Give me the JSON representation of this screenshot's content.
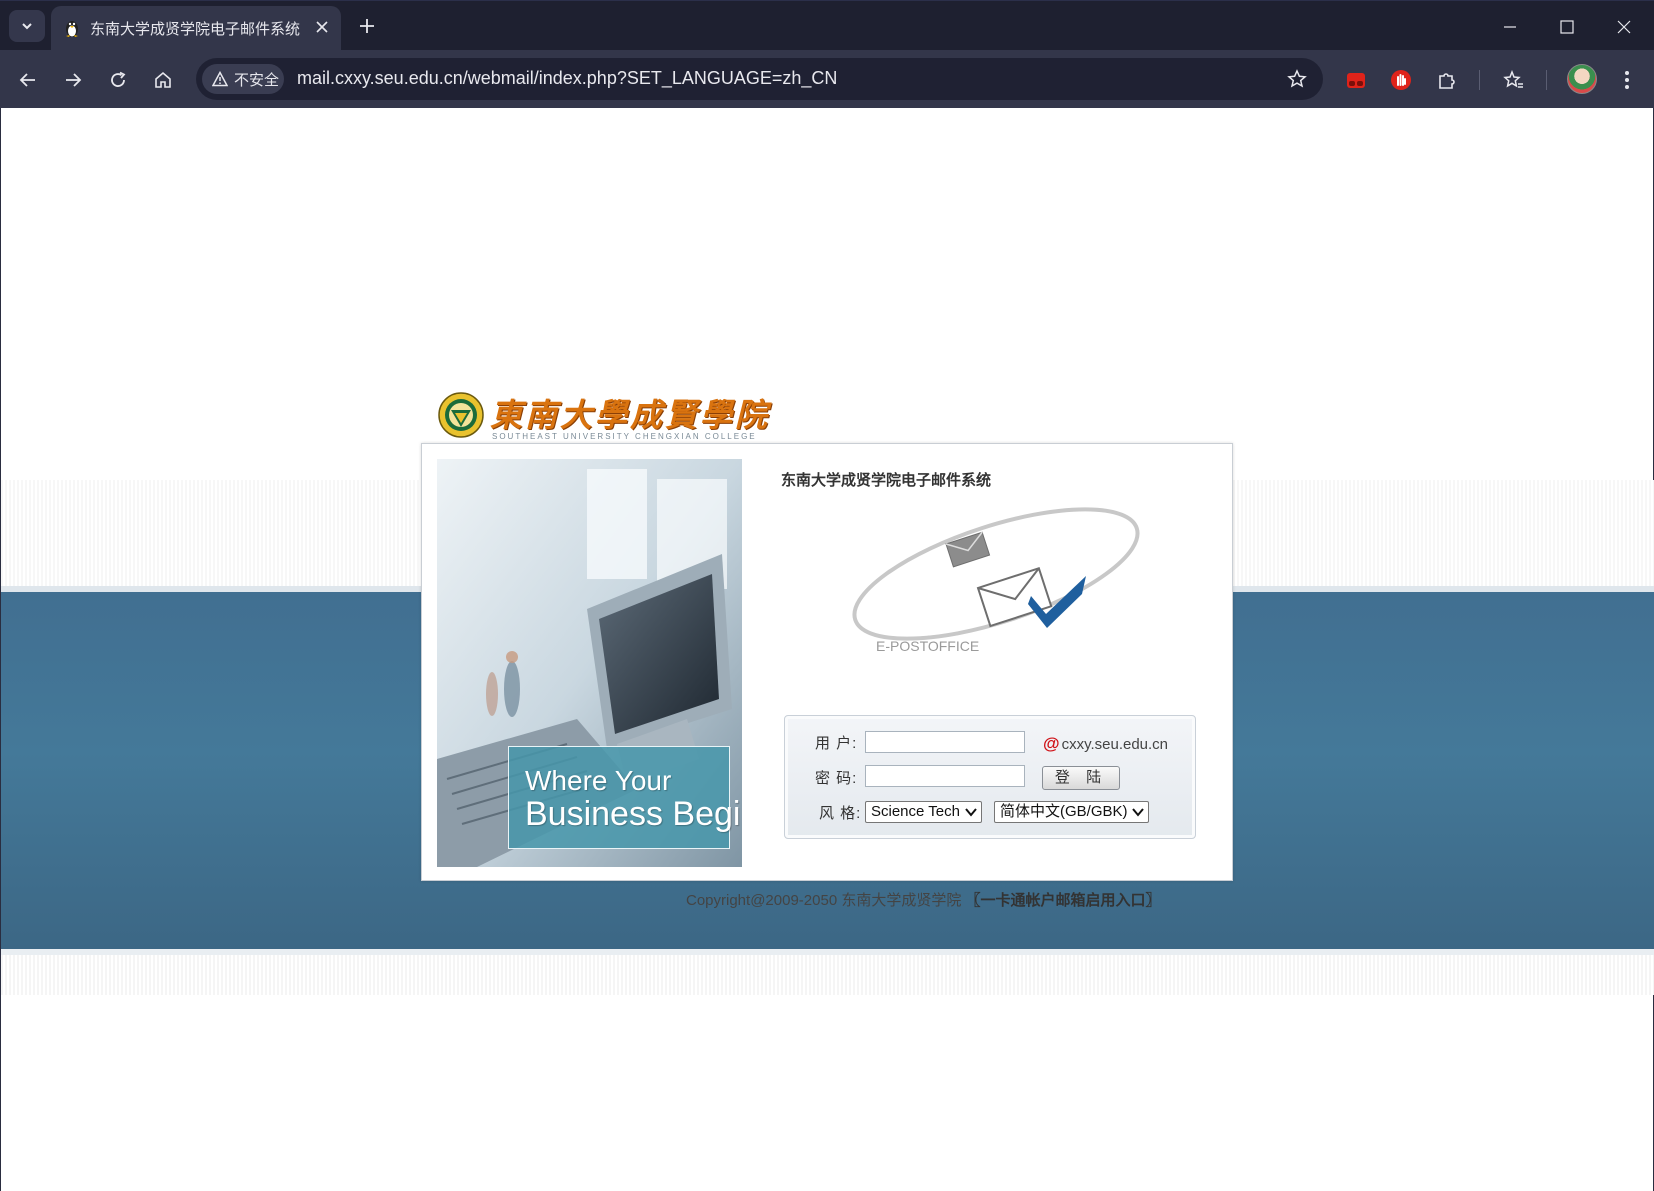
{
  "browser": {
    "tab_title": "东南大学成贤学院电子邮件系统",
    "security_label": "不安全",
    "url": "mail.cxxy.seu.edu.cn/webmail/index.php?SET_LANGUAGE=zh_CN"
  },
  "logo": {
    "name_cn": "東南大學成賢學院",
    "name_en": "SOUTHEAST UNIVERSITY CHENGXIAN COLLEGE"
  },
  "banner": {
    "slogan_line1": "Where Your",
    "slogan_line2": "Business Begins !"
  },
  "login": {
    "system_title": "东南大学成贤学院电子邮件系统",
    "epost_label": "E-POSTOFFICE",
    "user_label": "用 户:",
    "user_value": "",
    "domain_at": "@",
    "domain": "cxxy.seu.edu.cn",
    "password_label": "密 码:",
    "password_value": "",
    "login_button": "登 陆",
    "style_label": "风 格:",
    "style_selected": "Science Tech",
    "language_selected": "简体中文(GB/GBK)"
  },
  "footer": {
    "copyright": "Copyright@2009-2050 东南大学成贤学院",
    "link_text": "〖一卡通帐户邮箱启用入口〗"
  },
  "colors": {
    "band": "#447999",
    "logo_orange": "#d9730f",
    "accent_red": "#d0141a",
    "chrome_dark": "#1e2030",
    "chrome_toolbar": "#33364a"
  }
}
